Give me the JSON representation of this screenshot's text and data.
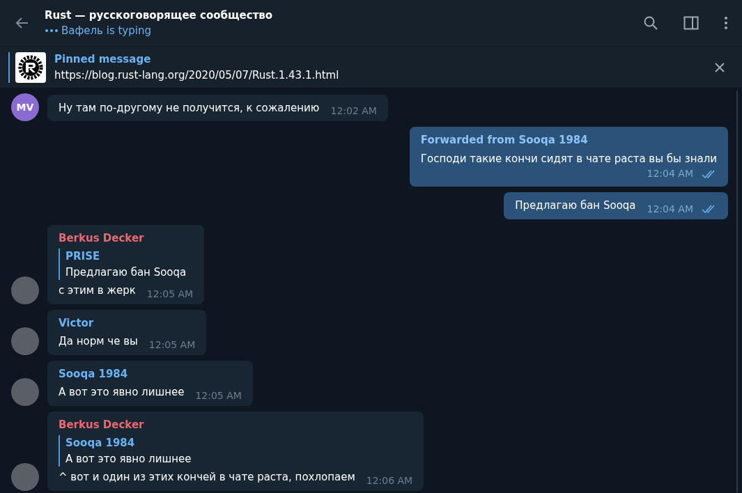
{
  "header": {
    "title": "Rust — русскоговорящее сообщество",
    "status": "Вафель is typing"
  },
  "pinned": {
    "label": "Pinned message",
    "text": "https://blog.rust-lang.org/2020/05/07/Rust.1.43.1.html"
  },
  "messages": [
    {
      "kind": "incoming",
      "avatar": {
        "kind": "initials",
        "initials": "MV"
      },
      "text": "Ну там по-другому не получится, к сожалению",
      "time": "12:02 AM"
    },
    {
      "kind": "outgoing",
      "forwarded": "Forwarded from Sooqa 1984",
      "text": "Господи такие кончи сидят в чате раста вы бы знали",
      "time": "12:04 AM",
      "read": true
    },
    {
      "kind": "outgoing",
      "text": "Предлагаю бан Sooqa",
      "time": "12:04 AM",
      "read": true
    },
    {
      "kind": "incoming",
      "avatar": {
        "kind": "photo"
      },
      "sender": "Berkus Decker",
      "color": "#e86a6f",
      "reply": {
        "name": "PRISE",
        "text": "Предлагаю бан Sooqa"
      },
      "text": "с этим в жерк",
      "time": "12:05 AM"
    },
    {
      "kind": "incoming",
      "avatar": {
        "kind": "photo"
      },
      "sender": "Victor",
      "color": "#6ab3f3",
      "text": "Да норм че вы",
      "time": "12:05 AM"
    },
    {
      "kind": "incoming",
      "avatar": {
        "kind": "photo"
      },
      "sender": "Sooqa 1984",
      "color": "#6ab3f3",
      "text": "А вот это явно лишнее",
      "time": "12:05 AM"
    },
    {
      "kind": "incoming",
      "avatar": {
        "kind": "photo"
      },
      "sender": "Berkus Decker",
      "color": "#e86a6f",
      "reply": {
        "name": "Sooqa 1984",
        "text": "А вот это явно лишнее"
      },
      "text": "^ вот и один из этих кончей в чате раста, похлопаем",
      "time": "12:06 AM"
    }
  ]
}
